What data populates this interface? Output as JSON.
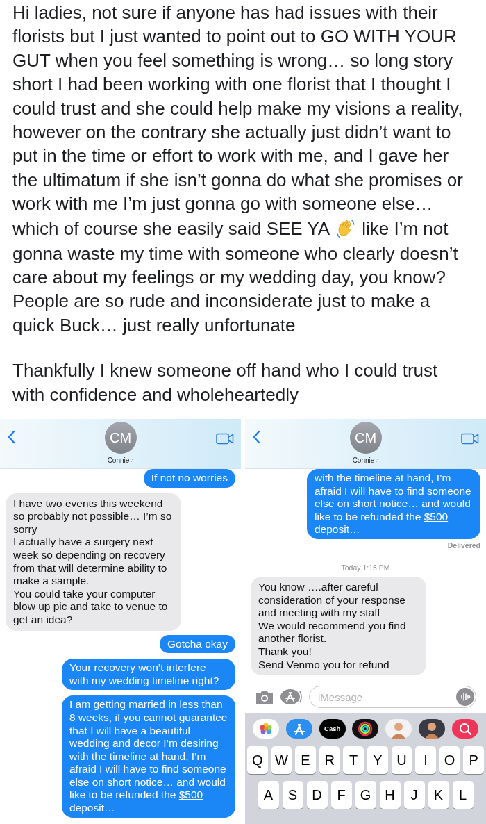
{
  "post": {
    "paragraphs": [
      {
        "parts": [
          {
            "kind": "text",
            "text": "Hi ladies, not sure if anyone has had issues with their florists but I just wanted to point out to GO WITH YOUR GUT when you feel something is wrong… so long story short I had been working with one florist that I thought I could trust and she could help make my visions a reality, however on the contrary she actually just didn’t want to put in the time or effort to work with me, and I gave her the ultimatum if she isn’t gonna do what she promises or work with me I’m just gonna go with someone else…"
          },
          {
            "kind": "line",
            "items": [
              {
                "kind": "text",
                "text": "which of course she easily said SEE YA"
              },
              {
                "kind": "waving-hand"
              },
              {
                "kind": "text",
                "text": "like I’m not"
              }
            ]
          },
          {
            "kind": "text",
            "text": "gonna waste my time with someone who clearly doesn’t care about my feelings or my wedding day, you know? People are so rude and inconsiderate just to make a quick Buck… just really unfortunate"
          }
        ]
      },
      {
        "parts": [
          {
            "kind": "text",
            "text": "Thankfully I knew someone off hand who I could trust with confidence and wholeheartedly"
          }
        ]
      }
    ]
  },
  "screenshots": [
    {
      "contact_initials": "CM",
      "contact_name": "Connie",
      "messages": [
        {
          "kind": "sent",
          "parts": [
            {
              "text": "If not no worries"
            }
          ]
        },
        {
          "kind": "received",
          "parts": [
            {
              "text": "I have two events this weekend so probably not possible… I’m so sorry\nI actually have a surgery next week so depending on recovery from that will determine ability to make a sample.\nYou could take your computer blow up pic and take to venue to get an idea?"
            }
          ]
        },
        {
          "kind": "sent",
          "parts": [
            {
              "text": "Gotcha okay"
            }
          ]
        },
        {
          "kind": "sent",
          "parts": [
            {
              "text": "Your recovery won’t interfere with my wedding timeline right?"
            }
          ]
        },
        {
          "kind": "sent",
          "parts": [
            {
              "text": "I am getting married in less than 8 weeks, if you cannot guarantee that I will have a beautiful wedding and decor I’m desiring with the timeline at hand, I’m afraid I will have to find someone else on short notice… and would like to be refunded the "
            },
            {
              "text": "$500",
              "link": true
            },
            {
              "text": " deposit…"
            }
          ]
        }
      ]
    },
    {
      "contact_initials": "CM",
      "contact_name": "Connie",
      "messages": [
        {
          "kind": "sent",
          "parts": [
            {
              "text": "with the timeline at hand, I’m afraid I will have to find someone else on short notice… and would like to be refunded the "
            },
            {
              "text": "$500",
              "link": true
            },
            {
              "text": " deposit…"
            }
          ]
        },
        {
          "kind": "status",
          "parts": [
            {
              "text": "Delivered"
            }
          ]
        },
        {
          "kind": "timestamp",
          "parts": [
            {
              "text": "Today 1:15 PM"
            }
          ]
        },
        {
          "kind": "received",
          "parts": [
            {
              "text": "You know ….after careful consideration of your response and meeting with my staff\nWe would recommend you find another florist.\nThank you!\nSend Venmo you for refund"
            }
          ]
        }
      ],
      "composer": {
        "placeholder": "iMessage"
      },
      "keyboard": {
        "apps": [
          {
            "kind": "photos"
          },
          {
            "kind": "app-store"
          },
          {
            "kind": "cash",
            "label": "Cash"
          },
          {
            "kind": "activity"
          },
          {
            "kind": "avatar"
          },
          {
            "kind": "avatar"
          },
          {
            "kind": "web-search"
          }
        ],
        "rows": [
          [
            "Q",
            "W",
            "E",
            "R",
            "T",
            "Y",
            "U",
            "I",
            "O",
            "P"
          ],
          [
            "A",
            "S",
            "D",
            "F",
            "G",
            "H",
            "J",
            "K",
            "L"
          ]
        ]
      }
    }
  ]
}
